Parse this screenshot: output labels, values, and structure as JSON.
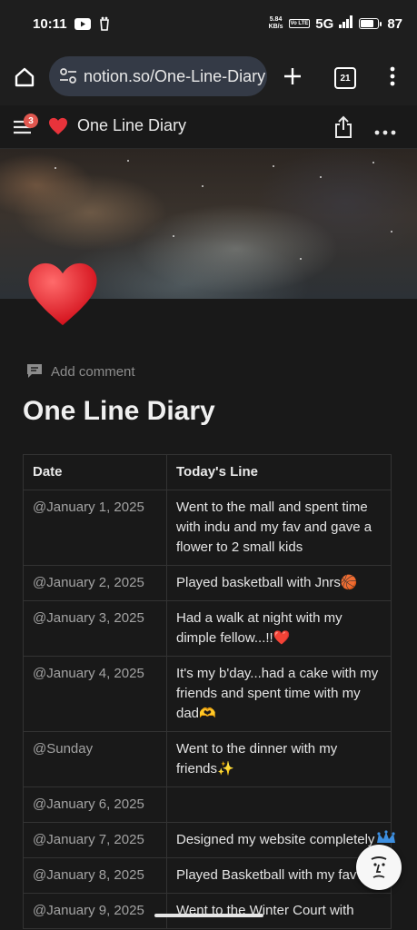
{
  "status_bar": {
    "time": "10:11",
    "net_speed_value": "5.84",
    "net_speed_unit": "KB/s",
    "volte": "Vo LTE",
    "network": "5G",
    "battery": "87",
    "battery_level": 0.87
  },
  "browser": {
    "url": "notion.so/One-Line-Diary",
    "tab_count": "21"
  },
  "notion_header": {
    "notification_count": "3",
    "page_name": "One Line Diary"
  },
  "page": {
    "add_comment": "Add comment",
    "title": "One Line Diary"
  },
  "table": {
    "headers": [
      "Date",
      "Today's Line"
    ],
    "rows": [
      {
        "date": "@January 1, 2025",
        "line": "Went to the mall and spent time with indu and my fav and gave a flower to 2 small kids"
      },
      {
        "date": "@January 2, 2025",
        "line": "Played basketball with Jnrs🏀"
      },
      {
        "date": "@January 3, 2025",
        "line": "Had a walk at night with my dimple fellow...!!❤️"
      },
      {
        "date": "@January 4, 2025",
        "line": "It's my b'day...had a cake with my friends and spent time with my dad🫶"
      },
      {
        "date": "@Sunday",
        "line": "Went to the dinner with my friends✨"
      },
      {
        "date": "@January 6, 2025",
        "line": ""
      },
      {
        "date": "@January 7, 2025",
        "line": "Designed my website completely"
      },
      {
        "date": "@January 8, 2025",
        "line": "Played Basketball with my favv..."
      },
      {
        "date": "@January 9, 2025",
        "line": "Went to the Winter Court with"
      }
    ]
  },
  "colors": {
    "background": "#191919",
    "badge": "#e0574f",
    "heart": "#e8333b"
  }
}
